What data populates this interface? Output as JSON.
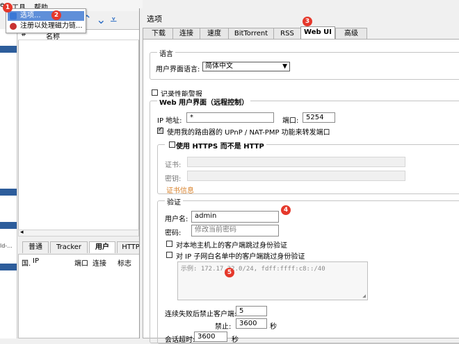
{
  "menubar": {
    "item_partial": "e",
    "tools": "工具",
    "help": "帮助"
  },
  "popup_menu": {
    "items": [
      {
        "label": "选项..."
      },
      {
        "label": "注册以处理磁力链..."
      }
    ]
  },
  "torrent_list": {
    "columns": [
      "#",
      "名称"
    ]
  },
  "peers_panel": {
    "tabs": [
      "普通",
      "Tracker",
      "用户",
      "HTTP"
    ],
    "columns": [
      "国.",
      "IP",
      "端口",
      "连接",
      "标志"
    ],
    "side_fragment": "ld-..."
  },
  "dialog": {
    "title": "选项",
    "tabs": [
      "下载",
      "连接",
      "速度",
      "BitTorrent",
      "RSS",
      "Web UI",
      "高级"
    ],
    "active_tab": "Web UI",
    "language_group": {
      "legend": "语言",
      "label": "用户界面语言:",
      "value": "简体中文"
    },
    "log_perf": {
      "label": "记录性能警报",
      "checked": false
    },
    "webui_group": {
      "legend": "Web 用户界面（远程控制）",
      "ip_label": "IP 地址:",
      "ip_value": "*",
      "port_label": "端口:",
      "port_value": "5254",
      "upnp_label": "使用我的路由器的 UPnP / NAT-PMP 功能来转发端口",
      "upnp_checked": true,
      "https_group": {
        "legend": "使用 HTTPS 而不是 HTTP",
        "checked": false,
        "cert_label": "证书:",
        "key_label": "密钥:",
        "cert_info": "证书信息"
      },
      "auth_group": {
        "legend": "验证",
        "user_label": "用户名:",
        "user_value": "admin",
        "pass_label": "密码:",
        "pass_placeholder": "修改当前密码",
        "bypass_local": "对本地主机上的客户端跳过身份验证",
        "bypass_local_checked": false,
        "bypass_whitelist": "对 IP 子网白名单中的客户端跳过身份验证",
        "bypass_whitelist_checked": false,
        "whitelist_placeholder": "示例: 172.17.32.0/24, fdff:ffff:c8::/40",
        "ban_label": "连续失败后禁止客户端:",
        "ban_value": "5",
        "ban_for_label": "禁止:",
        "ban_for_value": "3600",
        "ban_for_unit": "秒",
        "timeout_label": "会话超时:",
        "timeout_value": "3600",
        "timeout_unit": "秒"
      }
    }
  },
  "step_badges": [
    "1",
    "2",
    "3",
    "4",
    "5"
  ],
  "colors": {
    "accent": "#2b6cc4",
    "badge": "#e5382b",
    "selection": "#5f8fd9"
  }
}
